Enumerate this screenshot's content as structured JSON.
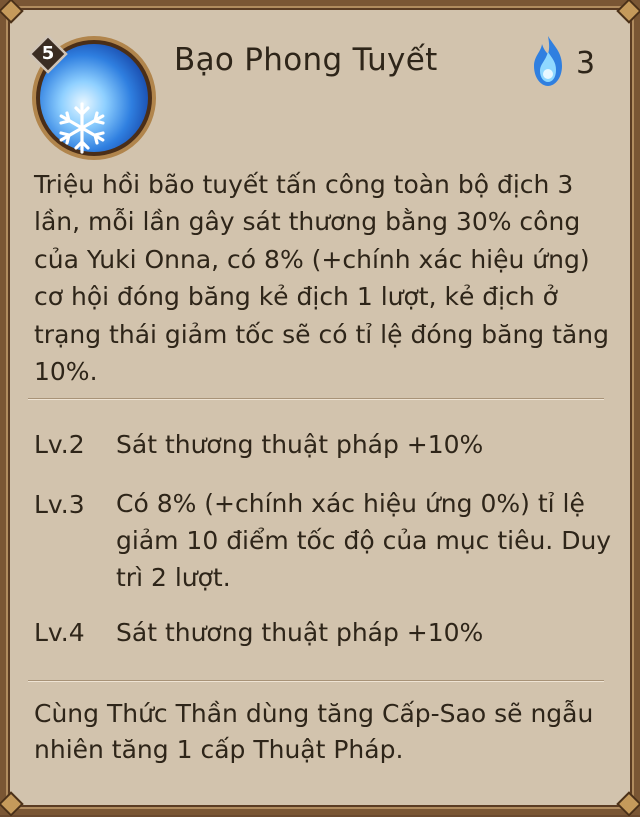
{
  "skill": {
    "name": "Bạo Phong Tuyết",
    "level_badge": "5",
    "cost": "3",
    "icon": "snowflake-icon",
    "cost_icon": "blue-flame-icon",
    "description": "Triệu hồi bão tuyết tấn công toàn bộ địch 3 lần, mỗi lần gây sát thương bằng 30% công của Yuki Onna, có 8% (+chính xác hiệu ứng) cơ hội đóng băng kẻ địch 1 lượt, kẻ địch ở trạng thái giảm tốc sẽ có tỉ lệ đóng băng tăng 10%."
  },
  "upgrades": [
    {
      "level": "Lv.2",
      "text": "Sát thương thuật pháp +10%"
    },
    {
      "level": "Lv.3",
      "text": "Có 8% (+chính xác hiệu ứng 0%) tỉ lệ giảm 10 điểm tốc độ của mục tiêu. Duy trì 2 lượt."
    },
    {
      "level": "Lv.4",
      "text": "Sát thương thuật pháp +10%"
    }
  ],
  "footer": "Cùng Thức Thần dùng tăng Cấp-Sao sẽ ngẫu nhiên tăng 1 cấp Thuật Pháp.",
  "colors": {
    "panel": "#d2c3ad",
    "border": "#7a5634",
    "text": "#2e2519",
    "icon_blue": "#2f7fe0"
  }
}
